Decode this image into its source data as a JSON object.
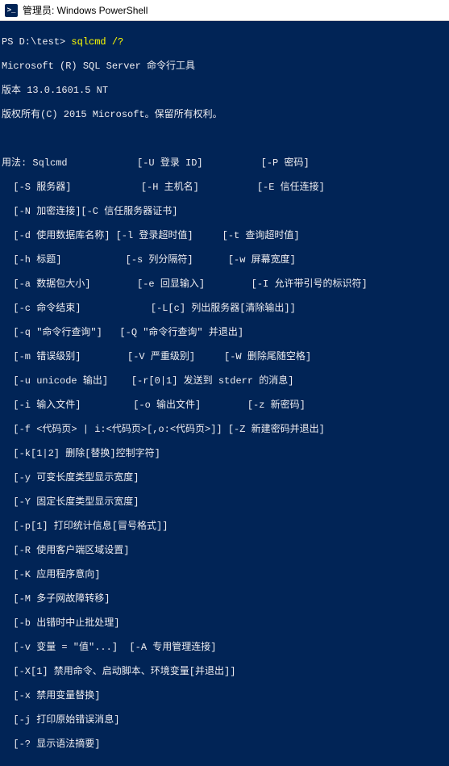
{
  "window": {
    "title": "管理员: Windows PowerShell"
  },
  "prompt": {
    "ps": "PS ",
    "path": "D:\\test>",
    "space": " ",
    "command": "sqlcmd /?"
  },
  "header": {
    "l1": "Microsoft (R) SQL Server 命令行工具",
    "l2": "版本 13.0.1601.5 NT",
    "l3": "版权所有(C) 2015 Microsoft。保留所有权利。"
  },
  "usage": [
    "用法: Sqlcmd            [-U 登录 ID]          [-P 密码]",
    "  [-S 服务器]            [-H 主机名]          [-E 信任连接]",
    "  [-N 加密连接][-C 信任服务器证书]",
    "  [-d 使用数据库名称] [-l 登录超时值]     [-t 查询超时值]",
    "  [-h 标题]           [-s 列分隔符]      [-w 屏幕宽度]",
    "  [-a 数据包大小]        [-e 回显输入]        [-I 允许带引号的标识符]",
    "  [-c 命令结束]            [-L[c] 列出服务器[清除输出]]",
    "  [-q \"命令行查询\"]   [-Q \"命令行查询\" 并退出]",
    "  [-m 错误级别]        [-V 严重级别]     [-W 删除尾随空格]",
    "  [-u unicode 输出]    [-r[0|1] 发送到 stderr 的消息]",
    "  [-i 输入文件]         [-o 输出文件]        [-z 新密码]",
    "  [-f <代码页> | i:<代码页>[,o:<代码页>]] [-Z 新建密码并退出]",
    "  [-k[1|2] 删除[替换]控制字符]",
    "  [-y 可变长度类型显示宽度]",
    "  [-Y 固定长度类型显示宽度]",
    "  [-p[1] 打印统计信息[冒号格式]]",
    "  [-R 使用客户端区域设置]",
    "  [-K 应用程序意向]",
    "  [-M 多子网故障转移]",
    "  [-b 出错时中止批处理]",
    "  [-v 变量 = \"值\"...]  [-A 专用管理连接]",
    "  [-X[1] 禁用命令、启动脚本、环境变量[并退出]]",
    "  [-x 禁用变量替换]",
    "  [-j 打印原始错误消息]",
    "  [-? 显示语法摘要]"
  ]
}
